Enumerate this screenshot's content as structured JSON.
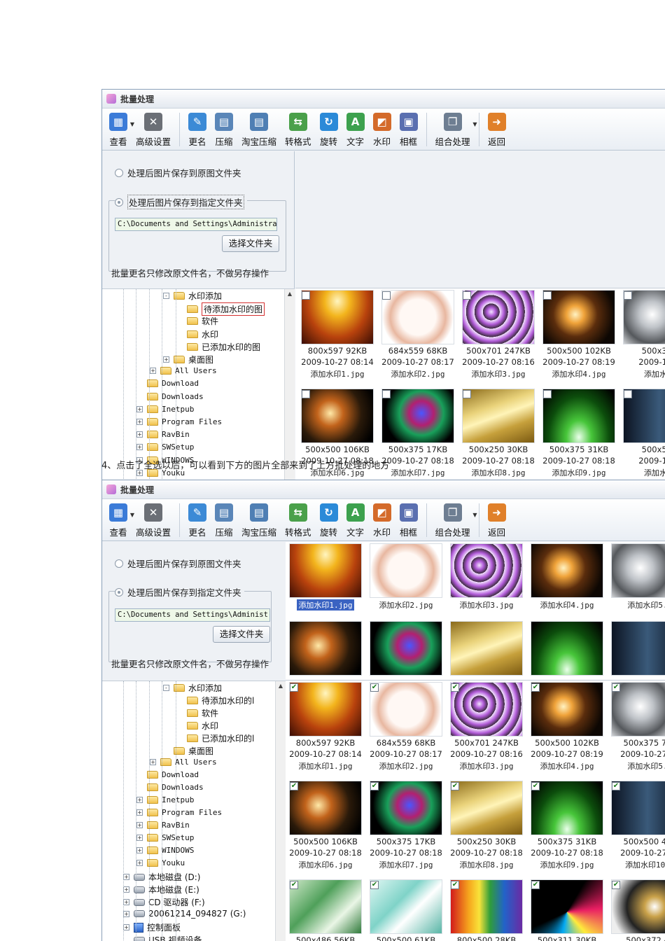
{
  "window_title": "批量处理",
  "toolbar": [
    {
      "label": "查看",
      "icon": "grid-view-icon",
      "color": "#3b7bd8",
      "arrow": true
    },
    {
      "label": "高级设置",
      "icon": "tools-icon",
      "color": "#6b6f76",
      "sep_after": true
    },
    {
      "label": "更名",
      "icon": "rename-icon",
      "color": "#3c8ad6"
    },
    {
      "label": "压缩",
      "icon": "compress-icon",
      "color": "#5a86b8"
    },
    {
      "label": "淘宝压缩",
      "icon": "taobao-compress-icon",
      "color": "#4f7fb4"
    },
    {
      "label": "转格式",
      "icon": "convert-icon",
      "color": "#4aa04a"
    },
    {
      "label": "旋转",
      "icon": "rotate-icon",
      "color": "#2b8ad8"
    },
    {
      "label": "文字",
      "icon": "text-icon",
      "color": "#3da14e"
    },
    {
      "label": "水印",
      "icon": "watermark-icon",
      "color": "#d46a2a"
    },
    {
      "label": "相框",
      "icon": "frame-icon",
      "color": "#5a6fb0",
      "sep_after": true
    },
    {
      "label": "组合处理",
      "icon": "combo-icon",
      "color": "#6e7e92",
      "arrow": true,
      "sep_after": true
    },
    {
      "label": "返回",
      "icon": "back-icon",
      "color": "#e0802a"
    }
  ],
  "options": {
    "save_original": "处理后图片保存到原图文件夹",
    "save_specified": "处理后图片保存到指定文件夹",
    "path1": "C:\\Documents and Settings\\Administra",
    "path2": "C:\\Documents and Settings\\Administ:",
    "choose_folder": "选择文件夹",
    "rename_note": "批量更名只修改原文件名，不做另存操作"
  },
  "tree1": [
    {
      "label": "水印添加",
      "level": 5,
      "expand": "-",
      "type": "folder"
    },
    {
      "label": "待添加水印的图",
      "level": 6,
      "type": "folder",
      "highlight": true
    },
    {
      "label": "软件",
      "level": 6,
      "type": "folder"
    },
    {
      "label": "水印",
      "level": 6,
      "type": "folder"
    },
    {
      "label": "已添加水印的图",
      "level": 6,
      "type": "folder"
    },
    {
      "label": "桌面图",
      "level": 5,
      "expand": "+",
      "type": "folder"
    },
    {
      "label": "All Users",
      "level": 4,
      "expand": "+",
      "type": "folder",
      "mono": true
    },
    {
      "label": "Download",
      "level": 3,
      "type": "folder",
      "mono": true
    },
    {
      "label": "Downloads",
      "level": 3,
      "type": "folder",
      "mono": true
    },
    {
      "label": "Inetpub",
      "level": 3,
      "expand": "+",
      "type": "folder",
      "mono": true
    },
    {
      "label": "Program Files",
      "level": 3,
      "expand": "+",
      "type": "folder",
      "mono": true
    },
    {
      "label": "RavBin",
      "level": 3,
      "expand": "+",
      "type": "folder",
      "mono": true
    },
    {
      "label": "SWSetup",
      "level": 3,
      "expand": "+",
      "type": "folder",
      "mono": true
    },
    {
      "label": "WINDOWS",
      "level": 3,
      "expand": "+",
      "type": "folder",
      "mono": true
    },
    {
      "label": "Youku",
      "level": 3,
      "expand": "+",
      "type": "folder",
      "mono": true
    }
  ],
  "tree2": [
    {
      "label": "水印添加",
      "level": 5,
      "expand": "-",
      "type": "folder"
    },
    {
      "label": "待添加水印的l",
      "level": 6,
      "type": "folder"
    },
    {
      "label": "软件",
      "level": 6,
      "type": "folder"
    },
    {
      "label": "水印",
      "level": 6,
      "type": "folder"
    },
    {
      "label": "已添加水印的l",
      "level": 6,
      "type": "folder"
    },
    {
      "label": "桌面图",
      "level": 5,
      "type": "folder"
    },
    {
      "label": "All Users",
      "level": 4,
      "expand": "+",
      "type": "folder",
      "mono": true
    },
    {
      "label": "Download",
      "level": 3,
      "type": "folder",
      "mono": true
    },
    {
      "label": "Downloads",
      "level": 3,
      "type": "folder",
      "mono": true
    },
    {
      "label": "Inetpub",
      "level": 3,
      "expand": "+",
      "type": "folder",
      "mono": true
    },
    {
      "label": "Program Files",
      "level": 3,
      "expand": "+",
      "type": "folder",
      "mono": true
    },
    {
      "label": "RavBin",
      "level": 3,
      "expand": "+",
      "type": "folder",
      "mono": true
    },
    {
      "label": "SWSetup",
      "level": 3,
      "expand": "+",
      "type": "folder",
      "mono": true
    },
    {
      "label": "WINDOWS",
      "level": 3,
      "expand": "+",
      "type": "folder",
      "mono": true
    },
    {
      "label": "Youku",
      "level": 3,
      "expand": "+",
      "type": "folder",
      "mono": true
    },
    {
      "label": "本地磁盘 (D:)",
      "level": 2,
      "expand": "+",
      "type": "drive"
    },
    {
      "label": "本地磁盘 (E:)",
      "level": 2,
      "expand": "+",
      "type": "drive"
    },
    {
      "label": "CD 驱动器 (F:)",
      "level": 2,
      "expand": "+",
      "type": "drive"
    },
    {
      "label": "20061214_094827 (G:)",
      "level": 2,
      "expand": "+",
      "type": "drive"
    },
    {
      "label": "控制面板",
      "level": 2,
      "expand": "+",
      "type": "cpl"
    },
    {
      "label": "USB 视频设备",
      "level": 2,
      "type": "drive"
    }
  ],
  "thumbs": [
    {
      "meta": "800x597 92KB",
      "date": "2009-10-27 08:14",
      "name": "添加水印1.jpg"
    },
    {
      "meta": "684x559 68KB",
      "date": "2009-10-27 08:17",
      "name": "添加水印2.jpg"
    },
    {
      "meta": "500x701 247KB",
      "date": "2009-10-27 08:16",
      "name": "添加水印3.jpg"
    },
    {
      "meta": "500x500 102KB",
      "date": "2009-10-27 08:19",
      "name": "添加水印4.jpg"
    },
    {
      "meta": "500x375",
      "date": "2009-10-2",
      "name": "添加水印"
    },
    {
      "meta": "500x500 106KB",
      "date": "2009-10-27 08:18",
      "name": "添加水印6.jpg"
    },
    {
      "meta": "500x375 17KB",
      "date": "2009-10-27 08:18",
      "name": "添加水印7.jpg"
    },
    {
      "meta": "500x250 30KB",
      "date": "2009-10-27 08:18",
      "name": "添加水印8.jpg"
    },
    {
      "meta": "500x375 31KB",
      "date": "2009-10-27 08:18",
      "name": "添加水印9.jpg"
    },
    {
      "meta": "500x500",
      "date": "2009-10-2",
      "name": "添加水印"
    }
  ],
  "thumbs2_sel": [
    {
      "name": "添加水印1.jpg",
      "selected": true
    },
    {
      "name": "添加水印2.jpg"
    },
    {
      "name": "添加水印3.jpg"
    },
    {
      "name": "添加水印4.jpg"
    },
    {
      "name": "添加水印5."
    }
  ],
  "thumbs2_all": [
    {
      "meta": "800x597 92KB",
      "date": "2009-10-27 08:14",
      "name": "添加水印1.jpg"
    },
    {
      "meta": "684x559 68KB",
      "date": "2009-10-27 08:17",
      "name": "添加水印2.jpg"
    },
    {
      "meta": "500x701 247KB",
      "date": "2009-10-27 08:16",
      "name": "添加水印3.jpg"
    },
    {
      "meta": "500x500 102KB",
      "date": "2009-10-27 08:19",
      "name": "添加水印4.jpg"
    },
    {
      "meta": "500x375 71",
      "date": "2009-10-27 0",
      "name": "添加水印5."
    },
    {
      "meta": "500x500 106KB",
      "date": "2009-10-27 08:18",
      "name": "添加水印6.jpg"
    },
    {
      "meta": "500x375 17KB",
      "date": "2009-10-27 08:18",
      "name": "添加水印7.jpg"
    },
    {
      "meta": "500x250 30KB",
      "date": "2009-10-27 08:18",
      "name": "添加水印8.jpg"
    },
    {
      "meta": "500x375 31KB",
      "date": "2009-10-27 08:18",
      "name": "添加水印9.jpg"
    },
    {
      "meta": "500x500 42",
      "date": "2009-10-27 0",
      "name": "添加水印10."
    },
    {
      "meta": "500x486 56KB"
    },
    {
      "meta": "500x500 61KB"
    },
    {
      "meta": "800x500 28KB"
    },
    {
      "meta": "500x311 30KB"
    },
    {
      "meta": "500x372 4"
    }
  ],
  "caption": "4、点击了全选以后，可以看到下方的图片全部来到了上方批处理的地方"
}
